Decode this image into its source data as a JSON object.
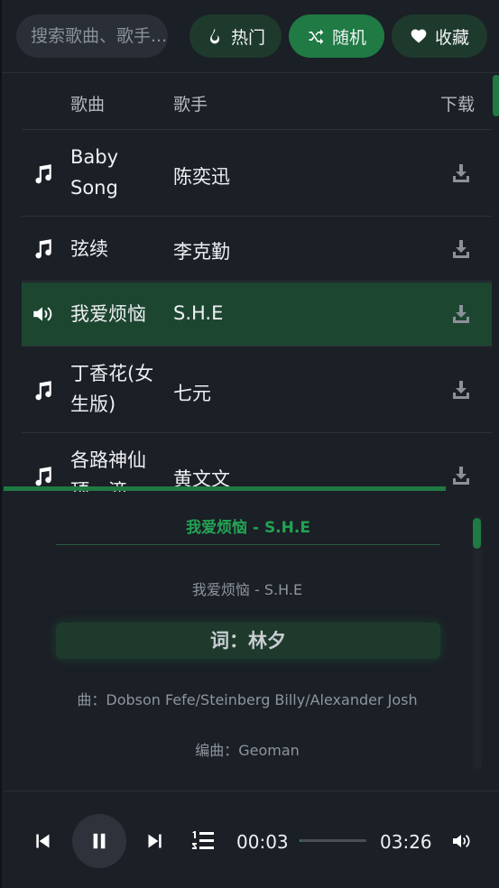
{
  "search": {
    "placeholder": "搜索歌曲、歌手..."
  },
  "tabs": [
    {
      "label": "热门",
      "icon": "fire-icon",
      "active": false
    },
    {
      "label": "随机",
      "icon": "shuffle-icon",
      "active": true
    },
    {
      "label": "收藏",
      "icon": "heart-icon",
      "active": false
    }
  ],
  "list": {
    "headers": {
      "song": "歌曲",
      "artist": "歌手",
      "download": "下载"
    },
    "rows": [
      {
        "title": "Baby Song",
        "artist": "陈奕迅",
        "playing": false
      },
      {
        "title": "弦续",
        "artist": "李克勤",
        "playing": false
      },
      {
        "title": "我爱烦恼",
        "artist": "S.H.E",
        "playing": true
      },
      {
        "title": "丁香花(女生版)",
        "artist": "七元",
        "playing": false
      },
      {
        "title": "各路神仙顶一滴",
        "artist": "黄文文",
        "playing": false
      }
    ]
  },
  "lyrics": {
    "header": "我爱烦恼 - S.H.E",
    "lines": [
      "我爱烦恼 - S.H.E",
      "词：林夕",
      "曲：Dobson Fefe/Steinberg Billy/Alexander Josh",
      "编曲：Geoman"
    ],
    "current_index": 1
  },
  "player": {
    "current_time": "00:03",
    "total_time": "03:26",
    "progress": 0.015
  },
  "colors": {
    "accent": "#1f7a43",
    "accent_text": "#22a354",
    "background": "#1b1f26",
    "playing_row": "#1d4631"
  }
}
